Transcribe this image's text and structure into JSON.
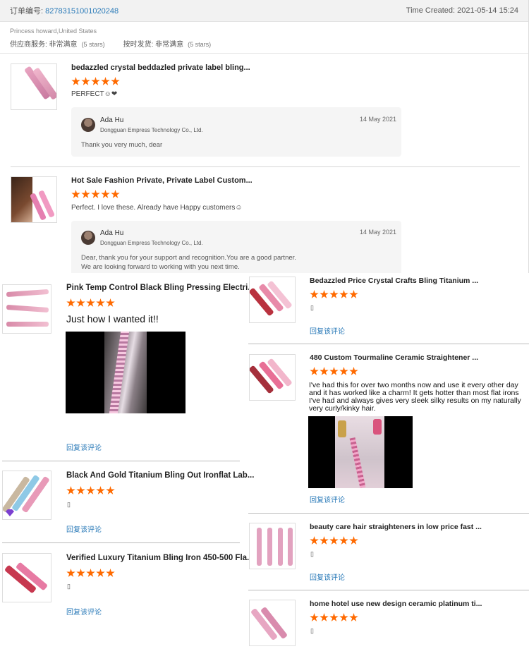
{
  "order": {
    "number_label": "订单编号:",
    "number": "82783151001020248",
    "time_created": "Time Created: 2021-05-14 15:24"
  },
  "buyer": {
    "location": "Princess howard,United States",
    "supplier_service_label": "供应商服务: 非常满意",
    "supplier_service_stars": "(5 stars)",
    "ontime_label": "按时发货: 非常满意",
    "ontime_stars": "(5 stars)"
  },
  "reviews": [
    {
      "title": "bedazzled crystal beddazled private label bling...",
      "rating": 5,
      "text": "PERFECT☺❤",
      "reply": {
        "name": "Ada Hu",
        "company": "Dongguan Empress Technology Co., Ltd.",
        "date": "14 May 2021",
        "line1": "Thank you very much, dear",
        "line2": ""
      }
    },
    {
      "title": "Hot Sale Fashion Private, Private Label Custom...",
      "rating": 5,
      "text": "Perfect. I love these. Already have Happy customers☺",
      "reply": {
        "name": "Ada Hu",
        "company": "Dongguan Empress Technology Co., Ltd.",
        "date": "14 May 2021",
        "line1": "Dear, thank you for your support and recognition.You are a good partner.",
        "line2": "We are looking forward to working with you next time."
      }
    }
  ],
  "left_items": [
    {
      "title": "Pink Temp Control Black Bling Pressing Electri...",
      "rating": 5,
      "text": "Just how I wanted it!!",
      "reply_link": "回复该评论"
    },
    {
      "title": "Black And Gold Titanium Bling Out Ironflat Lab...",
      "rating": 5,
      "text": "▯",
      "reply_link": "回复该评论"
    },
    {
      "title": "Verified Luxury Titanium Bling Iron 450-500 Fla...",
      "rating": 5,
      "text": "▯",
      "reply_link": "回复该评论"
    }
  ],
  "right_items": [
    {
      "title": "Bedazzled Price Crystal Crafts Bling Titanium ...",
      "rating": 5,
      "text": "▯",
      "reply_link": "回复该评论"
    },
    {
      "title": "480 Custom Tourmaline Ceramic Straightener ...",
      "rating": 5,
      "text_line1": "I've had this for over two months now and use it every other day",
      "text_line2": "and it has worked like a charm! It gets hotter than most flat irons",
      "text_line3": "I've had and always gives very sleek silky results on my naturally",
      "text_line4": "very curly/kinky hair.",
      "reply_link": "回复该评论"
    },
    {
      "title": "beauty care hair straighteners in low price fast ...",
      "rating": 5,
      "text": "▯",
      "reply_link": "回复该评论"
    },
    {
      "title": "home hotel use new design ceramic platinum ti...",
      "rating": 5,
      "text": "▯"
    }
  ],
  "colors": {
    "star": "#ff6a00",
    "link": "#2a7ab8"
  }
}
